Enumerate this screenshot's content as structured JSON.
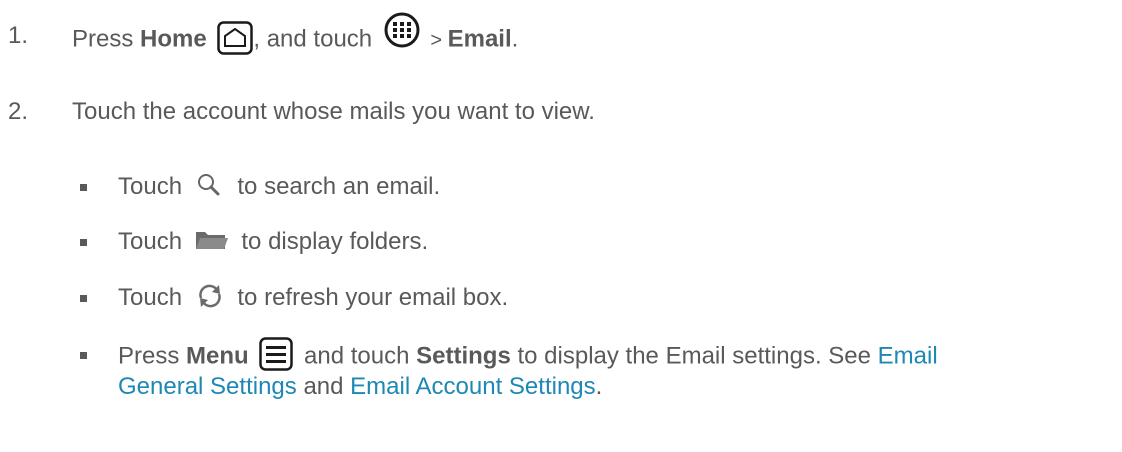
{
  "steps": [
    {
      "number": "1.",
      "t1": "Press ",
      "b1": "Home",
      "t2": ", and touch ",
      "t3": " > ",
      "b2": "Email",
      "t4": "."
    },
    {
      "number": "2.",
      "text": "Touch the account whose mails you want to view."
    }
  ],
  "bullets": [
    {
      "pre": "Touch ",
      "post": " to search an email.",
      "icon": "search-icon"
    },
    {
      "pre": "Touch ",
      "post": " to display folders.",
      "icon": "folder-icon"
    },
    {
      "pre": "Touch ",
      "post": " to refresh your email box.",
      "icon": "refresh-icon"
    },
    {
      "t1": "Press ",
      "b1": "Menu",
      "t2": " and touch ",
      "b2": "Settings",
      "t3": " to display the Email settings. See ",
      "link1_line1": "Email",
      "link1_line2": "General Settings",
      "t4": " and ",
      "link2": "Email Account Settings",
      "t5": ".",
      "icon": "menu-icon"
    }
  ]
}
